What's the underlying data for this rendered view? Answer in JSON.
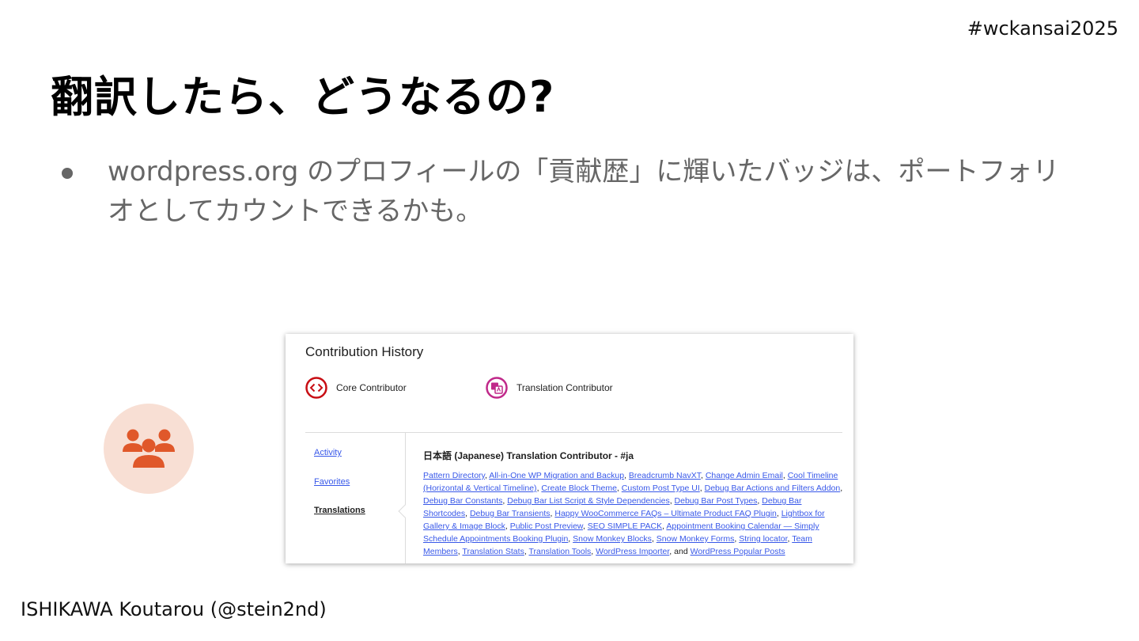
{
  "hashtag": "#wckansai2025",
  "title": "翻訳したら、どうなるの?",
  "bullet": "wordpress.org のプロフィールの「貢献歴」に輝いたバッジは、ポートフォリオとしてカウントできるかも。",
  "author": "ISHIKAWA Koutarou (@stein2nd)",
  "badge_icon": "people-group-icon",
  "colors": {
    "badge_bg": "#f8dfd4",
    "badge_fg": "#e0582a",
    "core": "#c80e14",
    "translation": "#c0298a",
    "link": "#3858e9"
  },
  "screenshot": {
    "title": "Contribution History",
    "badges": [
      {
        "label": "Core Contributor",
        "icon": "code-icon"
      },
      {
        "label": "Translation Contributor",
        "icon": "translate-icon"
      }
    ],
    "nav": [
      {
        "label": "Activity"
      },
      {
        "label": "Favorites"
      },
      {
        "label": "Translations"
      }
    ],
    "section_heading": "日本語 (Japanese) Translation Contributor - #ja",
    "plugins": [
      "Pattern Directory",
      "All-in-One WP Migration and Backup",
      "Breadcrumb NavXT",
      "Change Admin Email",
      "Cool Timeline (Horizontal & Vertical Timeline)",
      "Create Block Theme",
      "Custom Post Type UI",
      "Debug Bar Actions and Filters Addon",
      "Debug Bar Constants",
      "Debug Bar List Script & Style Dependencies",
      "Debug Bar Post Types",
      "Debug Bar Shortcodes",
      "Debug Bar Transients",
      "Happy WooCommerce FAQs – Ultimate Product FAQ Plugin",
      "Lightbox for Gallery & Image Block",
      "Public Post Preview",
      "SEO SIMPLE PACK",
      "Appointment Booking Calendar — Simply Schedule Appointments Booking Plugin",
      "Snow Monkey Blocks",
      "Snow Monkey Forms",
      "String locator",
      "Team Members",
      "Translation Stats",
      "Translation Tools",
      "WordPress Importer",
      "WordPress Popular Posts"
    ],
    "and_text": "and"
  }
}
